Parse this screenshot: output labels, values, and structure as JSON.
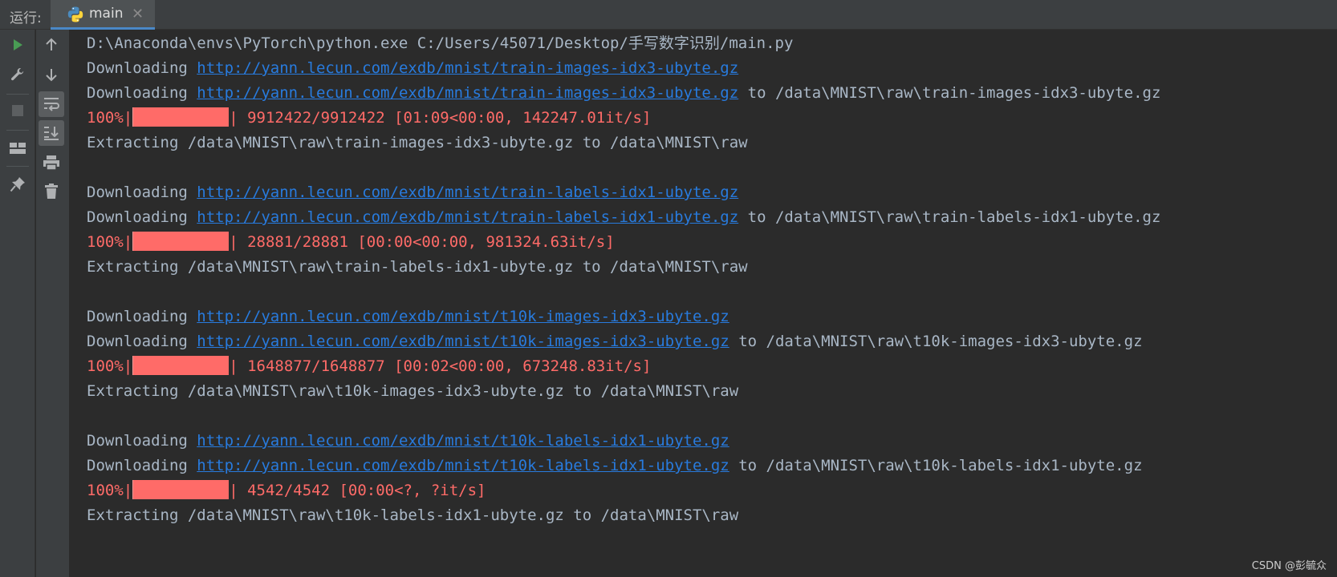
{
  "header": {
    "run_label": "运行:",
    "tab_label": "main",
    "tab_close": "✕"
  },
  "toolbar": {
    "left": [
      "run-icon",
      "wrench-icon",
      "stop-icon",
      "layout-icon",
      "pin-icon"
    ],
    "right": [
      "arrow-up-icon",
      "arrow-down-icon",
      "soft-wrap-icon",
      "scroll-to-end-icon",
      "print-icon",
      "trash-icon"
    ]
  },
  "console": {
    "command": "D:\\Anaconda\\envs\\PyTorch\\python.exe C:/Users/45071/Desktop/手写数字识别/main.py",
    "blocks": [
      {
        "dl1_prefix": "Downloading ",
        "url": "http://yann.lecun.com/exdb/mnist/train-images-idx3-ubyte.gz",
        "dl2_suffix": " to /data\\MNIST\\raw\\train-images-idx3-ubyte.gz",
        "progress_pct": "100%|",
        "progress_fill": 1.0,
        "progress_rest": "| 9912422/9912422 [01:09<00:00, 142247.01it/s]",
        "extract": "Extracting /data\\MNIST\\raw\\train-images-idx3-ubyte.gz to /data\\MNIST\\raw"
      },
      {
        "dl1_prefix": "Downloading ",
        "url": "http://yann.lecun.com/exdb/mnist/train-labels-idx1-ubyte.gz",
        "dl2_suffix": " to /data\\MNIST\\raw\\train-labels-idx1-ubyte.gz",
        "progress_pct": "100%|",
        "progress_fill": 1.0,
        "progress_rest": "| 28881/28881 [00:00<00:00, 981324.63it/s]",
        "extract": "Extracting /data\\MNIST\\raw\\train-labels-idx1-ubyte.gz to /data\\MNIST\\raw"
      },
      {
        "dl1_prefix": "Downloading ",
        "url": "http://yann.lecun.com/exdb/mnist/t10k-images-idx3-ubyte.gz",
        "dl2_suffix": " to /data\\MNIST\\raw\\t10k-images-idx3-ubyte.gz",
        "progress_pct": "100%|",
        "progress_fill": 1.0,
        "progress_rest": "| 1648877/1648877 [00:02<00:00, 673248.83it/s]",
        "extract": "Extracting /data\\MNIST\\raw\\t10k-images-idx3-ubyte.gz to /data\\MNIST\\raw"
      },
      {
        "dl1_prefix": "Downloading ",
        "url": "http://yann.lecun.com/exdb/mnist/t10k-labels-idx1-ubyte.gz",
        "dl2_suffix": " to /data\\MNIST\\raw\\t10k-labels-idx1-ubyte.gz",
        "progress_pct": "100%|",
        "progress_fill": 1.0,
        "progress_rest": "| 4542/4542 [00:00<?, ?it/s]",
        "extract": "Extracting /data\\MNIST\\raw\\t10k-labels-idx1-ubyte.gz to /data\\MNIST\\raw"
      }
    ]
  },
  "watermark": "CSDN @彭毓众",
  "colors": {
    "background": "#2b2b2b",
    "text": "#a9b7c6",
    "link": "#287bde",
    "stderr": "#ff6b68",
    "run_green": "#499c54"
  }
}
